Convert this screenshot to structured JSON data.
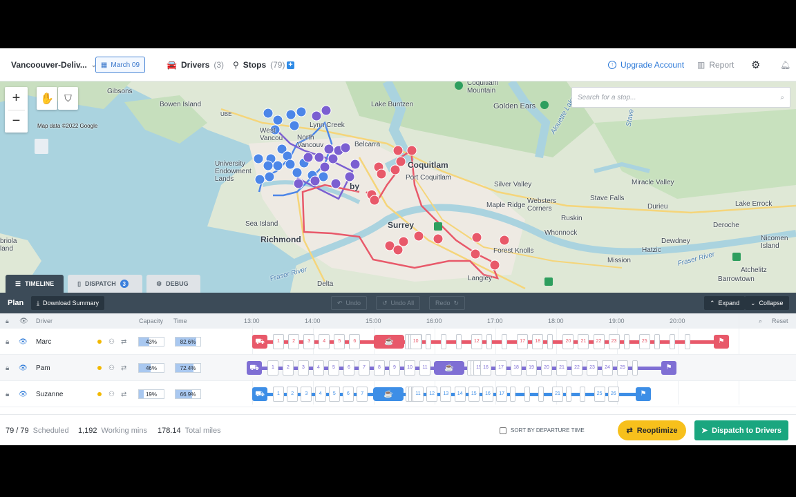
{
  "topbar": {
    "plan_name": "Vancoouver-Deliv...",
    "date": "March 09",
    "drivers_label": "Drivers",
    "drivers_count": "(3)",
    "stops_label": "Stops",
    "stops_count": "(79)",
    "add_icon": "plus-icon",
    "upgrade_label": "Upgrade Account",
    "report_label": "Report"
  },
  "map": {
    "search_placeholder": "Search for a stop...",
    "attribution": "Map data ©2022 Google",
    "zoom_in": "+",
    "zoom_out": "−",
    "labels": {
      "gibsons": "Gibsons",
      "bowen": "Bowen Island",
      "coquitlam_mtn": "Coquitlam\nMountain",
      "lake_buntzen": "Lake Buntzen",
      "golden_ears": "Golden Ears",
      "alouette": "Alouette Lake",
      "stave": "Stave",
      "lynn": "Lynn Creek",
      "west_van": "West\nVancou",
      "north": "North\nVancouv",
      "belcarra": "Belcarra",
      "coquitlam": "Coquitlam",
      "port_coquitlam": "Port Coquitlam",
      "silver_valley": "Silver Valley",
      "miracle_valley": "Miracle Valley",
      "ube": "UBE",
      "university": "University\nEndowment\nLands",
      "burnaby": "by",
      "maple_ridge": "Maple Ridge",
      "websters": "Websters\nCorners",
      "stave_falls": "Stave Falls",
      "durieu": "Durieu",
      "lake_errock": "Lake Errock",
      "sea_island": "Sea Island",
      "surrey": "Surrey",
      "ruskin": "Ruskin",
      "deroche": "Deroche",
      "richmond": "Richmond",
      "whonnock": "Whonnock",
      "dewdney": "Dewdney",
      "nicomen": "Nicomen\nIsland",
      "briola": "briola\nland",
      "forest_knolls": "Forest Knolls",
      "hatzic": "Hatzic",
      "fraser_river_e": "Fraser River",
      "mission": "Mission",
      "atchelitz": "Atchelitz",
      "fraser_river_w": "Fraser River",
      "delta": "Delta",
      "langley": "Langley",
      "barrowtown": "Barrowtown"
    }
  },
  "tabs": [
    {
      "label": "TIMELINE",
      "icon": "sliders-icon"
    },
    {
      "label": "DISPATCH",
      "icon": "phone-icon",
      "badge": "3"
    },
    {
      "label": "DEBUG",
      "icon": "gear-icon"
    }
  ],
  "planbar": {
    "title": "Plan",
    "download": "Download Summary",
    "undo": "Undo",
    "undo_all": "Undo All",
    "redo": "Redo",
    "expand": "Expand",
    "collapse": "Collapse"
  },
  "timeline": {
    "headers": {
      "driver": "Driver",
      "capacity": "Capacity",
      "time": "Time",
      "reset": "Reset"
    },
    "hours": [
      "13:00",
      "14:00",
      "15:00",
      "16:00",
      "17:00",
      "18:00",
      "19:00",
      "20:00"
    ],
    "drivers": [
      {
        "name": "Marc",
        "capacity": "43%",
        "capacity_value": 0.43,
        "time": "82.6%",
        "time_value": 0.826,
        "color": "#e8596a",
        "stops": [
          "1",
          "2",
          "3",
          "4",
          "5",
          "6",
          "7",
          "8",
          "9",
          "10",
          "",
          "",
          "",
          "12",
          "",
          "",
          "17",
          "18",
          "",
          "20",
          "21",
          "22",
          "23",
          "",
          "25",
          "",
          "",
          ""
        ]
      },
      {
        "name": "Pam",
        "capacity": "46%",
        "capacity_value": 0.46,
        "time": "72.4%",
        "time_value": 0.724,
        "color": "#7f6fd4",
        "stops": [
          "1",
          "2",
          "3",
          "4",
          "5",
          "6",
          "7",
          "8",
          "9",
          "10",
          "11",
          "13",
          "14",
          "15",
          "16",
          "17",
          "18",
          "19",
          "20",
          "21",
          "22",
          "23",
          "24",
          "25",
          ""
        ]
      },
      {
        "name": "Suzanne",
        "capacity": "19%",
        "capacity_value": 0.19,
        "time": "66.9%",
        "time_value": 0.669,
        "color": "#3d8ee6",
        "stops": [
          "1",
          "2",
          "3",
          "4",
          "5",
          "6",
          "7",
          "8",
          "9",
          "10",
          "11",
          "12",
          "13",
          "14",
          "15",
          "16",
          "17",
          "",
          "",
          "",
          "21",
          "",
          "",
          "25",
          "26"
        ]
      }
    ]
  },
  "footer": {
    "scheduled_value": "79 / 79",
    "scheduled_label": "Scheduled",
    "working_value": "1,192",
    "working_label": "Working mins",
    "miles_value": "178.14",
    "miles_label": "Total miles",
    "sort_label": "SORT BY DEPARTURE TIME",
    "reoptimize": "Reoptimize",
    "dispatch": "Dispatch to Drivers"
  }
}
